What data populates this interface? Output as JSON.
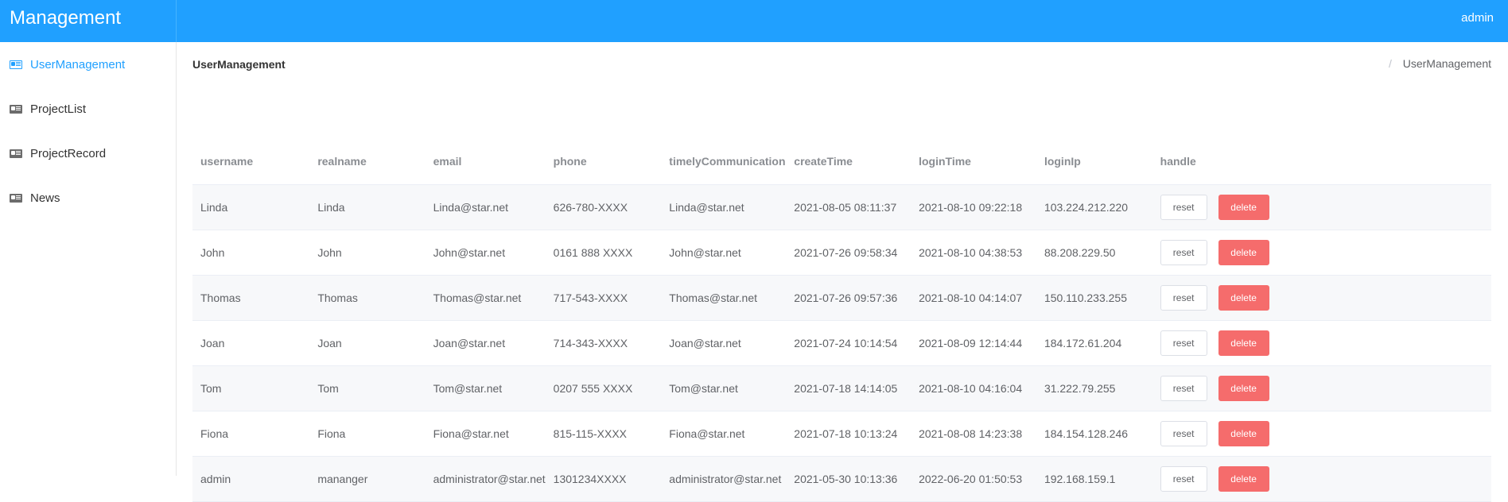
{
  "app": {
    "title": "Management",
    "user": "admin"
  },
  "sidebar": {
    "items": [
      {
        "label": "UserManagement",
        "icon": "id-card-icon",
        "active": true
      },
      {
        "label": "ProjectList",
        "icon": "id-card-icon",
        "active": false
      },
      {
        "label": "ProjectRecord",
        "icon": "id-card-icon",
        "active": false
      },
      {
        "label": "News",
        "icon": "id-card-icon",
        "active": false
      }
    ]
  },
  "main": {
    "title": "UserManagement",
    "breadcrumb": {
      "separator": "/",
      "current": "UserManagement"
    }
  },
  "table": {
    "columns": [
      "username",
      "realname",
      "email",
      "phone",
      "timelyCommunication",
      "createTime",
      "loginTime",
      "loginIp",
      "handle"
    ],
    "rows": [
      [
        "Linda",
        "Linda",
        "Linda@star.net",
        "626-780-XXXX",
        "Linda@star.net",
        "2021-08-05 08:11:37",
        "2021-08-10 09:22:18",
        "103.224.212.220"
      ],
      [
        "John",
        "John",
        "John@star.net",
        "0161 888 XXXX",
        "John@star.net",
        "2021-07-26 09:58:34",
        "2021-08-10 04:38:53",
        "88.208.229.50"
      ],
      [
        "Thomas",
        "Thomas",
        "Thomas@star.net",
        "717-543-XXXX",
        "Thomas@star.net",
        "2021-07-26 09:57:36",
        "2021-08-10 04:14:07",
        "150.110.233.255"
      ],
      [
        "Joan",
        "Joan",
        "Joan@star.net",
        "714-343-XXXX",
        "Joan@star.net",
        "2021-07-24 10:14:54",
        "2021-08-09 12:14:44",
        "184.172.61.204"
      ],
      [
        "Tom",
        "Tom",
        "Tom@star.net",
        "0207 555 XXXX",
        "Tom@star.net",
        "2021-07-18 14:14:05",
        "2021-08-10 04:16:04",
        "31.222.79.255"
      ],
      [
        "Fiona",
        "Fiona",
        "Fiona@star.net",
        "815-115-XXXX",
        "Fiona@star.net",
        "2021-07-18 10:13:24",
        "2021-08-08 14:23:38",
        "184.154.128.246"
      ],
      [
        "admin",
        "mananger",
        "administrator@star.net",
        "1301234XXXX",
        "administrator@star.net",
        "2021-05-30 10:13:36",
        "2022-06-20 01:50:53",
        "192.168.159.1"
      ]
    ],
    "actions": {
      "reset": "reset",
      "delete": "delete"
    }
  },
  "colors": {
    "header": "#20a0ff",
    "accent": "#20a0ff",
    "danger": "#f56c6c"
  }
}
